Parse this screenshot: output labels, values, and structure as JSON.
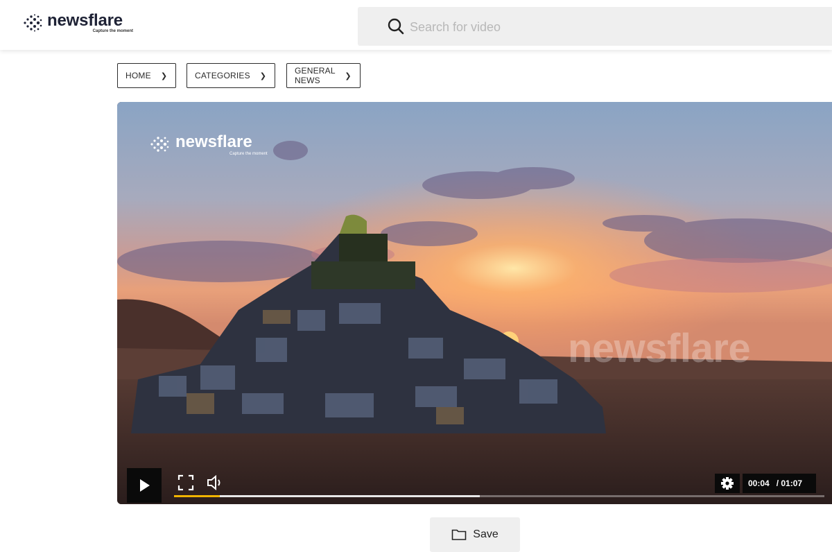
{
  "header": {
    "logo_text": "newsflare",
    "logo_tagline": "Capture the moment",
    "search_placeholder": "Search for video"
  },
  "breadcrumb": [
    {
      "label": "HOME"
    },
    {
      "label": "CATEGORIES"
    },
    {
      "label": "GENERAL NEWS"
    }
  ],
  "video": {
    "watermark_logo_text": "newsflare",
    "watermark_logo_tagline": "Capture the moment",
    "watermark_big": "newsflare",
    "current_time": "00:04",
    "duration": "/ 01:07",
    "progress_played_fraction": 0.07,
    "progress_buffered_fraction": 0.47,
    "accent_color": "#f0b400"
  },
  "icons": {
    "play": "play-icon",
    "fullscreen": "fullscreen-icon",
    "volume": "volume-icon",
    "settings": "gear-icon",
    "search": "search-icon",
    "save": "folder-icon"
  },
  "actions": {
    "save_label": "Save"
  }
}
